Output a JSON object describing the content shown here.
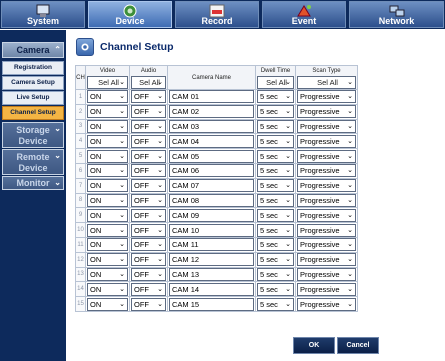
{
  "tabs": [
    {
      "label": "System",
      "icon": "system-icon"
    },
    {
      "label": "Device",
      "icon": "device-icon"
    },
    {
      "label": "Record",
      "icon": "record-icon"
    },
    {
      "label": "Event",
      "icon": "event-icon"
    },
    {
      "label": "Network",
      "icon": "network-icon"
    }
  ],
  "sidebar": {
    "camera": "Camera",
    "items": [
      "Registration",
      "Camera Setup",
      "Live Setup",
      "Channel Setup"
    ],
    "storage": "Storage Device",
    "remote": "Remote Device",
    "monitor": "Monitor"
  },
  "page": {
    "title": "Channel Setup"
  },
  "table": {
    "headers": {
      "ch": "CH",
      "video": "Video",
      "audio": "Audio",
      "camera_name": "Camera Name",
      "dwell": "Dwell Time",
      "scan": "Scan Type"
    },
    "header_selects": {
      "video": "Sel All",
      "audio": "Sel All",
      "dwell": "Sel All",
      "scan": "Sel All"
    },
    "rows": [
      {
        "ch": "1",
        "video": "ON",
        "audio": "OFF",
        "name": "CAM 01",
        "dwell": "5 sec",
        "scan": "Progressive"
      },
      {
        "ch": "2",
        "video": "ON",
        "audio": "OFF",
        "name": "CAM 02",
        "dwell": "5 sec",
        "scan": "Progressive"
      },
      {
        "ch": "3",
        "video": "ON",
        "audio": "OFF",
        "name": "CAM 03",
        "dwell": "5 sec",
        "scan": "Progressive"
      },
      {
        "ch": "4",
        "video": "ON",
        "audio": "OFF",
        "name": "CAM 04",
        "dwell": "5 sec",
        "scan": "Progressive"
      },
      {
        "ch": "5",
        "video": "ON",
        "audio": "OFF",
        "name": "CAM 05",
        "dwell": "5 sec",
        "scan": "Progressive"
      },
      {
        "ch": "6",
        "video": "ON",
        "audio": "OFF",
        "name": "CAM 06",
        "dwell": "5 sec",
        "scan": "Progressive"
      },
      {
        "ch": "7",
        "video": "ON",
        "audio": "OFF",
        "name": "CAM 07",
        "dwell": "5 sec",
        "scan": "Progressive"
      },
      {
        "ch": "8",
        "video": "ON",
        "audio": "OFF",
        "name": "CAM 08",
        "dwell": "5 sec",
        "scan": "Progressive"
      },
      {
        "ch": "9",
        "video": "ON",
        "audio": "OFF",
        "name": "CAM 09",
        "dwell": "5 sec",
        "scan": "Progressive"
      },
      {
        "ch": "10",
        "video": "ON",
        "audio": "OFF",
        "name": "CAM 10",
        "dwell": "5 sec",
        "scan": "Progressive"
      },
      {
        "ch": "11",
        "video": "ON",
        "audio": "OFF",
        "name": "CAM 11",
        "dwell": "5 sec",
        "scan": "Progressive"
      },
      {
        "ch": "12",
        "video": "ON",
        "audio": "OFF",
        "name": "CAM 12",
        "dwell": "5 sec",
        "scan": "Progressive"
      },
      {
        "ch": "13",
        "video": "ON",
        "audio": "OFF",
        "name": "CAM 13",
        "dwell": "5 sec",
        "scan": "Progressive"
      },
      {
        "ch": "14",
        "video": "ON",
        "audio": "OFF",
        "name": "CAM 14",
        "dwell": "5 sec",
        "scan": "Progressive"
      },
      {
        "ch": "15",
        "video": "ON",
        "audio": "OFF",
        "name": "CAM 15",
        "dwell": "5 sec",
        "scan": "Progressive"
      }
    ]
  },
  "buttons": {
    "ok": "OK",
    "cancel": "Cancel"
  },
  "colors": {
    "accent": "#0d2a5c",
    "active_menu": "#f4b544"
  }
}
